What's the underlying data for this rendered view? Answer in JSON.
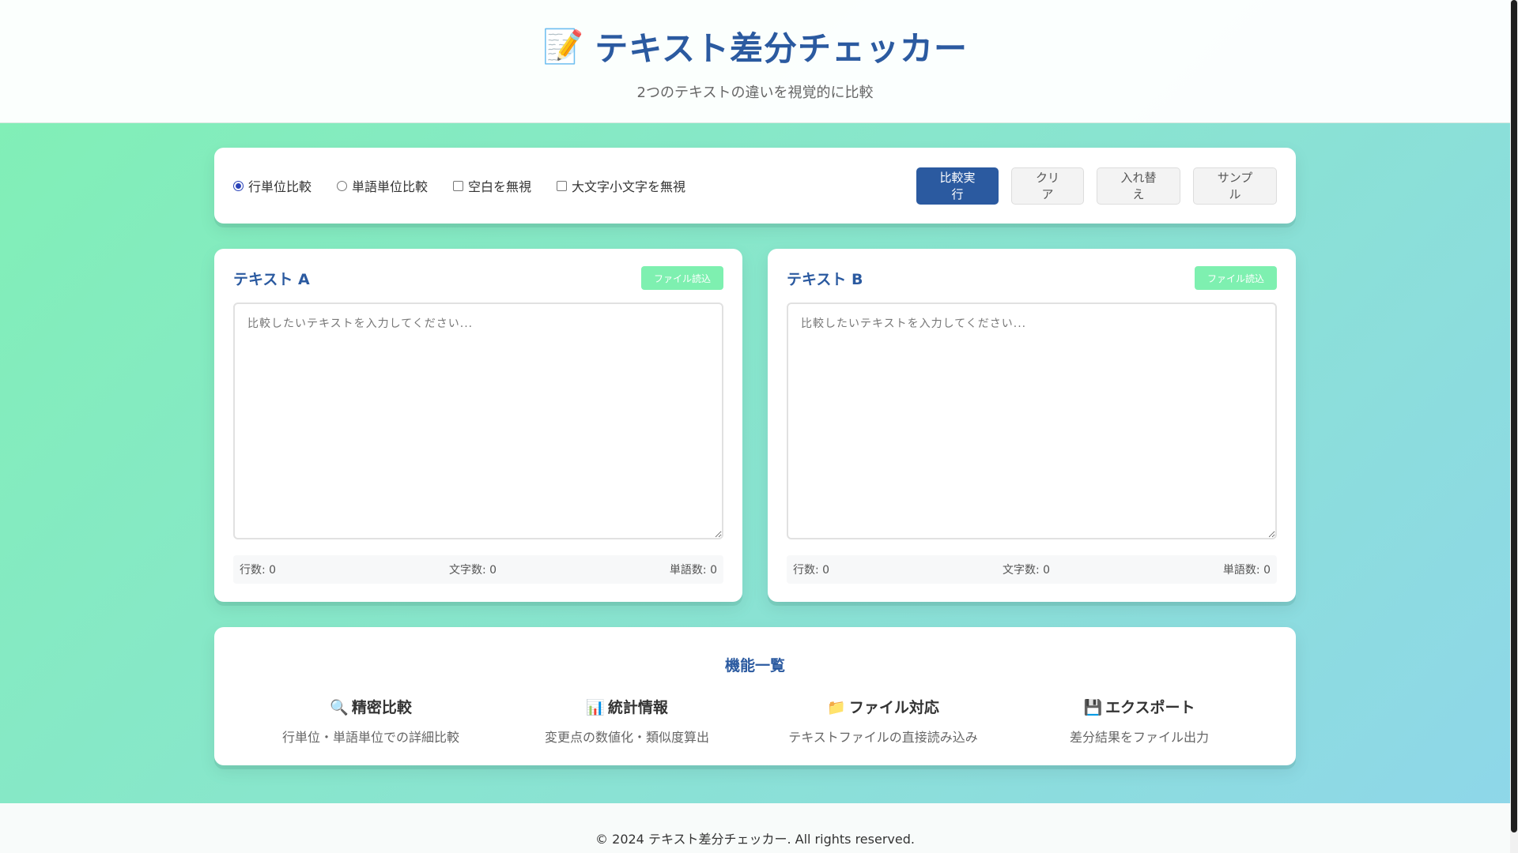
{
  "header": {
    "title_icon": "📝",
    "title": "テキスト差分チェッカー",
    "subtitle": "2つのテキストの違いを視覚的に比較"
  },
  "controls": {
    "options": [
      {
        "label": "行単位比較",
        "type": "radio",
        "checked": true
      },
      {
        "label": "単語単位比較",
        "type": "radio",
        "checked": false
      },
      {
        "label": "空白を無視",
        "type": "checkbox",
        "checked": false
      },
      {
        "label": "大文字小文字を無視",
        "type": "checkbox",
        "checked": false
      }
    ],
    "compare_label": "比較実行",
    "clear_label": "クリア",
    "swap_label": "入れ替え",
    "sample_label": "サンプル"
  },
  "panels": {
    "a": {
      "title": "テキスト A",
      "file_button": "ファイル読込",
      "placeholder": "比較したいテキストを入力してください...",
      "value": "",
      "stats": {
        "lines": "行数: 0",
        "chars": "文字数: 0",
        "words": "単語数: 0"
      }
    },
    "b": {
      "title": "テキスト B",
      "file_button": "ファイル読込",
      "placeholder": "比較したいテキストを入力してください...",
      "value": "",
      "stats": {
        "lines": "行数: 0",
        "chars": "文字数: 0",
        "words": "単語数: 0"
      }
    }
  },
  "features": {
    "title": "機能一覧",
    "items": [
      {
        "icon": "🔍",
        "name": "精密比較",
        "desc": "行単位・単語単位での詳細比較"
      },
      {
        "icon": "📊",
        "name": "統計情報",
        "desc": "変更点の数値化・類似度算出"
      },
      {
        "icon": "📁",
        "name": "ファイル対応",
        "desc": "テキストファイルの直接読み込み"
      },
      {
        "icon": "💾",
        "name": "エクスポート",
        "desc": "差分結果をファイル出力"
      }
    ]
  },
  "footer": {
    "text": "© 2024 テキスト差分チェッカー. All rights reserved."
  },
  "colors": {
    "accent": "#2b5aa0",
    "file_button": "#7ef0b0",
    "background_start": "#80f0b4",
    "background_end": "#8fd6ea"
  }
}
